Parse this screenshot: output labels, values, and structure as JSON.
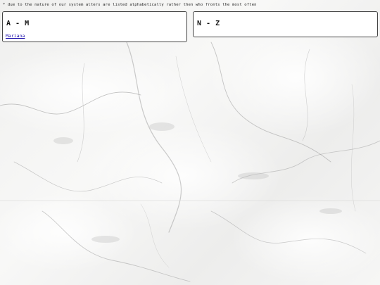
{
  "note": "* due to the nature of our system alters are listed alphabetically rather then who fronts the most often",
  "panels": {
    "left": {
      "heading": "A - M",
      "links": [
        "Mariana"
      ]
    },
    "right": {
      "heading": "N - Z",
      "links": []
    }
  },
  "colors": {
    "panel_bg": "#ffffff",
    "panel_border": "#444444",
    "link": "#1a0dab",
    "background": "marble-white-grey"
  }
}
